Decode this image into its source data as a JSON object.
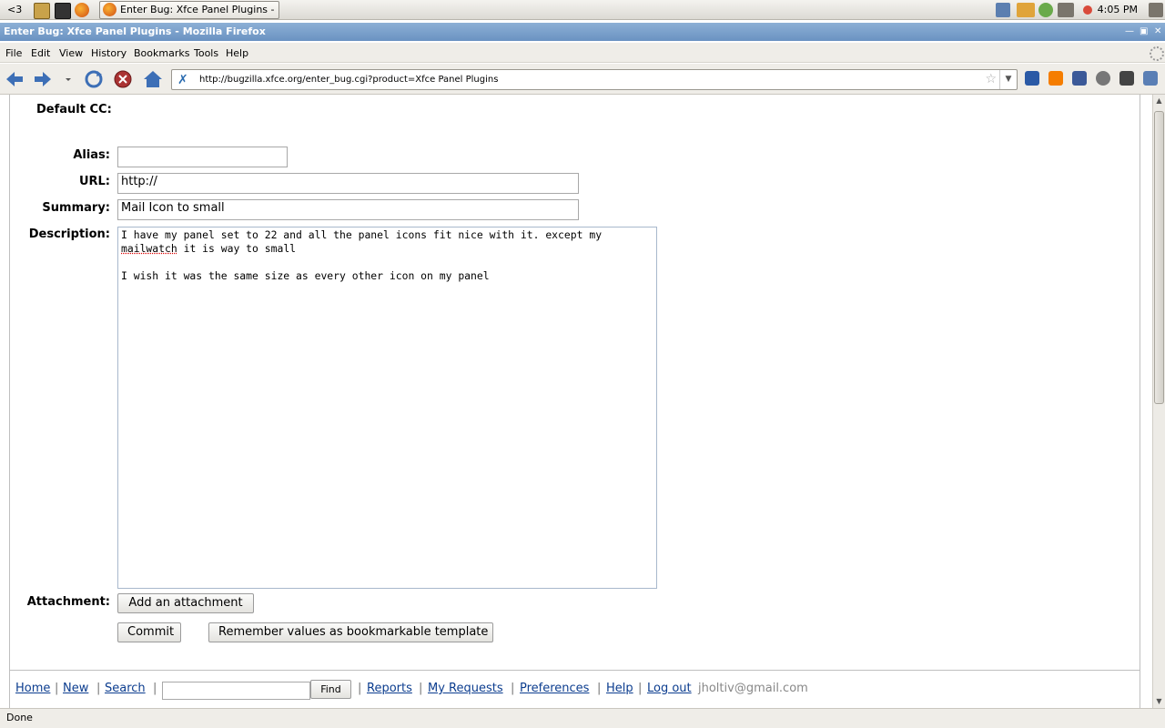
{
  "panel": {
    "workspace_label": "<3",
    "task_title": "Enter Bug: Xfce Panel Plugins - M...",
    "clock": "4:05 PM"
  },
  "window": {
    "title": "Enter Bug: Xfce Panel Plugins - Mozilla Firefox"
  },
  "menu": {
    "file": "File",
    "edit": "Edit",
    "view": "View",
    "history": "History",
    "bookmarks": "Bookmarks",
    "tools": "Tools",
    "help": "Help"
  },
  "nav": {
    "url": "http://bugzilla.xfce.org/enter_bug.cgi?product=Xfce Panel Plugins"
  },
  "form": {
    "default_cc_label": "Default CC:",
    "alias_label": "Alias:",
    "alias_value": "",
    "url_label": "URL:",
    "url_value": "http://",
    "summary_label": "Summary:",
    "summary_value": "Mail Icon to small",
    "description_label": "Description:",
    "description_line1": "I have my panel set to 22 and all the panel icons fit nice with it. except my",
    "description_spell_word": "mailwatch",
    "description_line2_rest": " it is way to small",
    "description_line4": "I wish it was the same size as every other icon on my panel",
    "attachment_label": "Attachment:",
    "add_attachment_button": "Add an attachment",
    "commit_button": "Commit",
    "remember_button": "Remember values as bookmarkable template"
  },
  "footer": {
    "home": "Home",
    "new": "New",
    "search": "Search",
    "search_value": "",
    "find_button": "Find",
    "reports": "Reports",
    "my_requests": "My Requests",
    "preferences": "Preferences",
    "help": "Help",
    "logout": "Log out",
    "user": "jholtiv@gmail.com",
    "separator": "|"
  },
  "status": {
    "text": "Done"
  },
  "colors": {
    "link": "#0c3d8f",
    "titlebar": "#7aa0cc"
  }
}
